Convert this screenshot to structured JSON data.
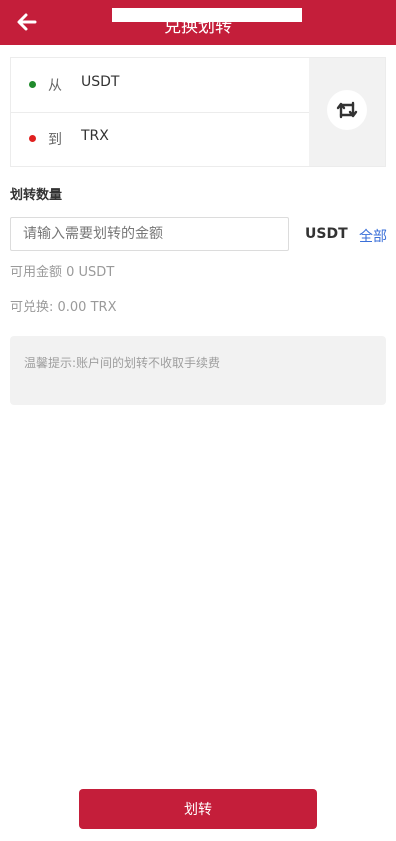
{
  "header": {
    "title": "兑换划转",
    "back_icon": "arrow-left-icon",
    "color": "#c41e3a"
  },
  "pair": {
    "from": {
      "label": "从",
      "coin": "USDT",
      "dot_color": "#1f8a2b"
    },
    "to": {
      "label": "到",
      "coin": "TRX",
      "dot_color": "#e0201f"
    },
    "swap_icon": "swap-icon"
  },
  "amount": {
    "section_title": "划转数量",
    "placeholder": "请输入需要划转的金额",
    "unit": "USDT",
    "all_label": "全部",
    "available": "可用金额 0 USDT",
    "exchangeable": "可兑换: 0.00 TRX"
  },
  "tip": {
    "text": "温馨提示:账户间的划转不收取手续费"
  },
  "submit_label": "划转"
}
